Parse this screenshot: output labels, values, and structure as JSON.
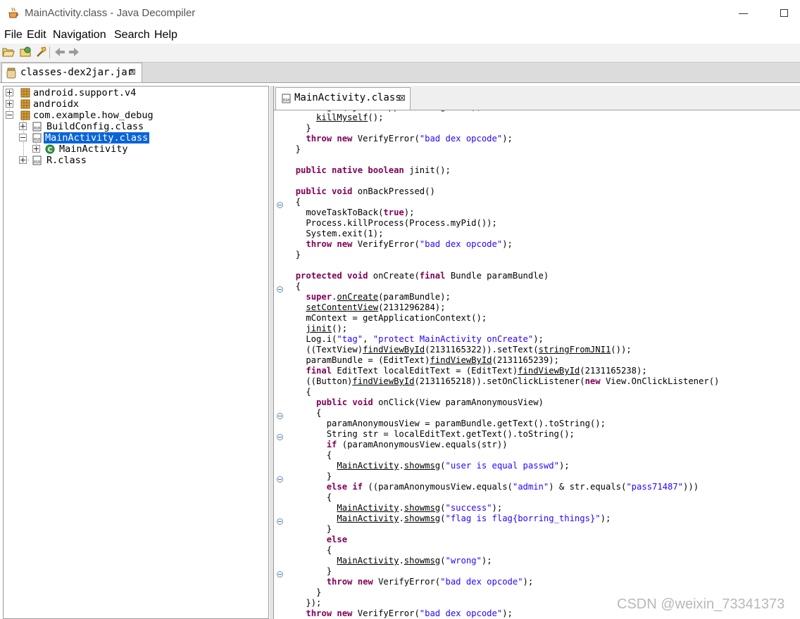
{
  "window": {
    "title": "MainActivity.class - Java Decompiler",
    "icon": "coffee-cup-icon"
  },
  "menu": [
    "File",
    "Edit",
    "Navigation",
    "Search",
    "Help"
  ],
  "toolbar": [
    "open-file-icon",
    "open-type-icon",
    "search-icon",
    "back-arrow-icon",
    "forward-arrow-icon"
  ],
  "jar_tab": {
    "label": "classes-dex2jar.jar",
    "close": "⊠"
  },
  "tree": [
    {
      "label": "android.support.v4"
    },
    {
      "label": "androidx"
    },
    {
      "label": "com.example.how_debug"
    },
    {
      "label": "BuildConfig.class"
    },
    {
      "label": "MainActivity.class"
    },
    {
      "label": "MainActivity"
    },
    {
      "label": "R.class"
    }
  ],
  "class_tab": {
    "label": "MainActivity.class",
    "close": "⊠"
  },
  "code": [
    [
      {
        "t": "      Log.i(\"jw\", \"app is debugable\");"
      }
    ],
    [
      {
        "t": "      "
      },
      {
        "t": "killMyself",
        "c": "ln"
      },
      {
        "t": "();"
      }
    ],
    [
      {
        "t": "    }"
      }
    ],
    [
      {
        "t": "    "
      },
      {
        "t": "throw new",
        "c": "kw"
      },
      {
        "t": " VerifyError("
      },
      {
        "t": "\"bad dex opcode\"",
        "c": "st"
      },
      {
        "t": ");"
      }
    ],
    [
      {
        "t": "  }"
      }
    ],
    [
      {
        "t": ""
      }
    ],
    [
      {
        "t": "  "
      },
      {
        "t": "public native boolean",
        "c": "kw"
      },
      {
        "t": " jinit();"
      }
    ],
    [
      {
        "t": ""
      }
    ],
    [
      {
        "t": "  "
      },
      {
        "t": "public void",
        "c": "kw"
      },
      {
        "t": " onBackPressed()"
      }
    ],
    [
      {
        "t": "  {"
      }
    ],
    [
      {
        "t": "    moveTaskToBack("
      },
      {
        "t": "true",
        "c": "kw"
      },
      {
        "t": ");"
      }
    ],
    [
      {
        "t": "    Process.killProcess(Process.myPid());"
      }
    ],
    [
      {
        "t": "    System.exit(1);"
      }
    ],
    [
      {
        "t": "    "
      },
      {
        "t": "throw new",
        "c": "kw"
      },
      {
        "t": " VerifyError("
      },
      {
        "t": "\"bad dex opcode\"",
        "c": "st"
      },
      {
        "t": ");"
      }
    ],
    [
      {
        "t": "  }"
      }
    ],
    [
      {
        "t": ""
      }
    ],
    [
      {
        "t": "  "
      },
      {
        "t": "protected void",
        "c": "kw"
      },
      {
        "t": " onCreate("
      },
      {
        "t": "final",
        "c": "kw"
      },
      {
        "t": " Bundle paramBundle)"
      }
    ],
    [
      {
        "t": "  {"
      }
    ],
    [
      {
        "t": "    "
      },
      {
        "t": "super",
        "c": "kw"
      },
      {
        "t": "."
      },
      {
        "t": "onCreate",
        "c": "ln"
      },
      {
        "t": "(paramBundle);"
      }
    ],
    [
      {
        "t": "    "
      },
      {
        "t": "setContentView",
        "c": "ln"
      },
      {
        "t": "(2131296284);"
      }
    ],
    [
      {
        "t": "    mContext = getApplicationContext();"
      }
    ],
    [
      {
        "t": "    "
      },
      {
        "t": "jinit",
        "c": "ln"
      },
      {
        "t": "();"
      }
    ],
    [
      {
        "t": "    Log.i("
      },
      {
        "t": "\"tag\"",
        "c": "st"
      },
      {
        "t": ", "
      },
      {
        "t": "\"protect MainActivity onCreate\"",
        "c": "st"
      },
      {
        "t": ");"
      }
    ],
    [
      {
        "t": "    ((TextView)"
      },
      {
        "t": "findViewById",
        "c": "ln"
      },
      {
        "t": "(2131165322)).setText("
      },
      {
        "t": "stringFromJNI1",
        "c": "ln"
      },
      {
        "t": "());"
      }
    ],
    [
      {
        "t": "    paramBundle = (EditText)"
      },
      {
        "t": "findViewById",
        "c": "ln"
      },
      {
        "t": "(2131165239);"
      }
    ],
    [
      {
        "t": "    "
      },
      {
        "t": "final",
        "c": "kw"
      },
      {
        "t": " EditText localEditText = (EditText)"
      },
      {
        "t": "findViewById",
        "c": "ln"
      },
      {
        "t": "(2131165238);"
      }
    ],
    [
      {
        "t": "    ((Button)"
      },
      {
        "t": "findViewById",
        "c": "ln"
      },
      {
        "t": "(2131165218)).setOnClickListener("
      },
      {
        "t": "new",
        "c": "kw"
      },
      {
        "t": " View.OnClickListener()"
      }
    ],
    [
      {
        "t": "    {"
      }
    ],
    [
      {
        "t": "      "
      },
      {
        "t": "public void",
        "c": "kw"
      },
      {
        "t": " onClick(View paramAnonymousView)"
      }
    ],
    [
      {
        "t": "      {"
      }
    ],
    [
      {
        "t": "        paramAnonymousView = paramBundle.getText().toString();"
      }
    ],
    [
      {
        "t": "        String str = localEditText.getText().toString();"
      }
    ],
    [
      {
        "t": "        "
      },
      {
        "t": "if",
        "c": "kw"
      },
      {
        "t": " (paramAnonymousView.equals(str))"
      }
    ],
    [
      {
        "t": "        {"
      }
    ],
    [
      {
        "t": "          "
      },
      {
        "t": "MainActivity",
        "c": "ln"
      },
      {
        "t": "."
      },
      {
        "t": "showmsg",
        "c": "ln"
      },
      {
        "t": "("
      },
      {
        "t": "\"user is equal passwd\"",
        "c": "st"
      },
      {
        "t": ");"
      }
    ],
    [
      {
        "t": "        }"
      }
    ],
    [
      {
        "t": "        "
      },
      {
        "t": "else if",
        "c": "kw"
      },
      {
        "t": " ((paramAnonymousView.equals("
      },
      {
        "t": "\"admin\"",
        "c": "st"
      },
      {
        "t": ") & str.equals("
      },
      {
        "t": "\"pass71487\"",
        "c": "st"
      },
      {
        "t": ")))"
      }
    ],
    [
      {
        "t": "        {"
      }
    ],
    [
      {
        "t": "          "
      },
      {
        "t": "MainActivity",
        "c": "ln"
      },
      {
        "t": "."
      },
      {
        "t": "showmsg",
        "c": "ln"
      },
      {
        "t": "("
      },
      {
        "t": "\"success\"",
        "c": "st"
      },
      {
        "t": ");"
      }
    ],
    [
      {
        "t": "          "
      },
      {
        "t": "MainActivity",
        "c": "ln"
      },
      {
        "t": "."
      },
      {
        "t": "showmsg",
        "c": "ln"
      },
      {
        "t": "("
      },
      {
        "t": "\"flag is flag{borring_things}\"",
        "c": "st"
      },
      {
        "t": ");"
      }
    ],
    [
      {
        "t": "        }"
      }
    ],
    [
      {
        "t": "        "
      },
      {
        "t": "else",
        "c": "kw"
      }
    ],
    [
      {
        "t": "        {"
      }
    ],
    [
      {
        "t": "          "
      },
      {
        "t": "MainActivity",
        "c": "ln"
      },
      {
        "t": "."
      },
      {
        "t": "showmsg",
        "c": "ln"
      },
      {
        "t": "("
      },
      {
        "t": "\"wrong\"",
        "c": "st"
      },
      {
        "t": ");"
      }
    ],
    [
      {
        "t": "        }"
      }
    ],
    [
      {
        "t": "        "
      },
      {
        "t": "throw new",
        "c": "kw"
      },
      {
        "t": " VerifyError("
      },
      {
        "t": "\"bad dex opcode\"",
        "c": "st"
      },
      {
        "t": ");"
      }
    ],
    [
      {
        "t": "      }"
      }
    ],
    [
      {
        "t": "    });"
      }
    ],
    [
      {
        "t": "    "
      },
      {
        "t": "throw new",
        "c": "kw"
      },
      {
        "t": " VerifyError("
      },
      {
        "t": "\"bad dex opcode\"",
        "c": "st"
      },
      {
        "t": ");"
      }
    ]
  ],
  "watermark": "CSDN @weixin_73341373",
  "colors": {
    "keyword": "#7f0055",
    "string": "#2a00ff",
    "selection": "#0a64d6"
  }
}
